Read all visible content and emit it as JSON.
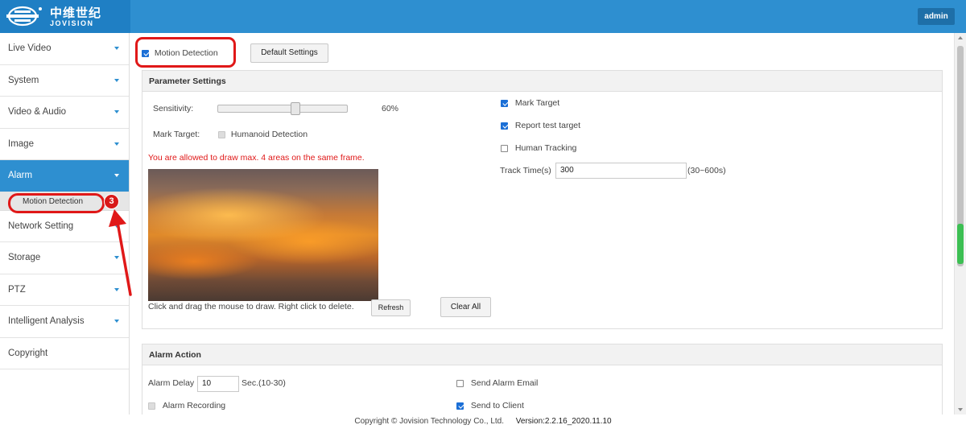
{
  "header": {
    "logo_cn": "中维世纪",
    "logo_en": "JOVISION",
    "user_button": "admin"
  },
  "sidebar": {
    "items": [
      {
        "label": "Live Video",
        "has_caret": true
      },
      {
        "label": "System",
        "has_caret": true
      },
      {
        "label": "Video & Audio",
        "has_caret": true
      },
      {
        "label": "Image",
        "has_caret": true
      },
      {
        "label": "Alarm",
        "has_caret": true,
        "active": true
      },
      {
        "label": "Network Setting",
        "has_caret": true
      },
      {
        "label": "Storage",
        "has_caret": true
      },
      {
        "label": "PTZ",
        "has_caret": true
      },
      {
        "label": "Intelligent Analysis",
        "has_caret": true
      },
      {
        "label": "Copyright",
        "has_caret": false
      }
    ],
    "sub_item": "Motion Detection"
  },
  "annotation": {
    "step_number": "3"
  },
  "top_controls": {
    "motion_detection_label": "Motion Detection",
    "motion_detection_checked": true,
    "default_settings_button": "Default Settings"
  },
  "parameter_settings": {
    "title": "Parameter Settings",
    "sensitivity_label": "Sensitivity:",
    "sensitivity_value": "60%",
    "sensitivity_fraction": 0.6,
    "mark_target_label": "Mark Target:",
    "humanoid_detection_label": "Humanoid Detection",
    "warning_text": "You are allowed to draw max. 4 areas on the same frame.",
    "draw_hint": "Click and drag the mouse to draw. Right click to delete.",
    "refresh_button": "Refresh",
    "clear_all_button": "Clear All",
    "right_options": {
      "mark_target": "Mark Target",
      "report_test_target": "Report test target",
      "human_tracking": "Human Tracking",
      "track_time_label": "Track Time(s)",
      "track_time_value": "300",
      "track_time_range": "(30~600s)"
    }
  },
  "alarm_action": {
    "title": "Alarm Action",
    "alarm_delay_label": "Alarm Delay",
    "alarm_delay_value": "10",
    "alarm_delay_unit": "Sec.(10-30)",
    "alarm_recording_label": "Alarm Recording",
    "send_alarm_email_label": "Send Alarm Email",
    "send_to_client_label": "Send to Client"
  },
  "footer": {
    "copyright": "Copyright © Jovision Technology Co., Ltd.",
    "version": "Version:2.2.16_2020.11.10"
  },
  "colors": {
    "header_blue": "#2e8fd0",
    "active_nav": "#2e8fd0",
    "warning_red": "#e01818",
    "annotation_red": "#e01818"
  }
}
